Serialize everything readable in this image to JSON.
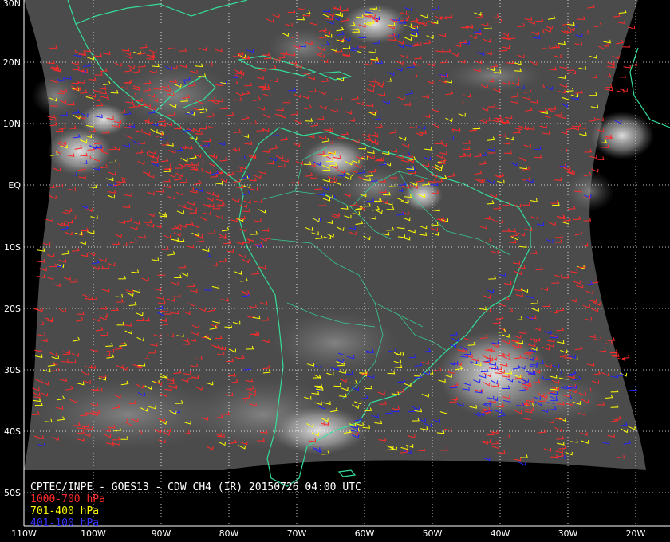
{
  "map": {
    "title": "CPTEC/INPE - GOES13 - CDW CH4 (IR) 20150726 04:00 UTC",
    "latitudes": [
      "30N",
      "20N",
      "10N",
      "EQ",
      "10S",
      "20S",
      "30S",
      "40S",
      "50S"
    ],
    "longitudes": [
      "110W",
      "100W",
      "90W",
      "80W",
      "70W",
      "60W",
      "50W",
      "40W",
      "30W",
      "20W"
    ],
    "legend": [
      {
        "label": "1000-700 hPa",
        "color": "#ff2a2a"
      },
      {
        "label": "701-400 hPa",
        "color": "#ffff00"
      },
      {
        "label": "401-100 hPa",
        "color": "#2222ff"
      }
    ],
    "colors": {
      "background": "#000000",
      "satellite_disk": "#4a4a4a",
      "coastline": "#33dd99",
      "grid": "#ffffff"
    }
  }
}
